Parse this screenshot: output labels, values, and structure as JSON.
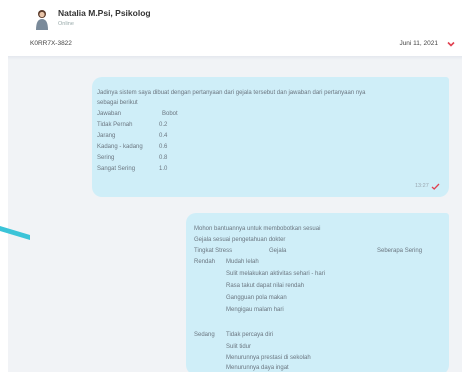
{
  "header": {
    "contact_name": "Natalia M.Psi, Psikolog",
    "contact_status": "Online",
    "ticket_id": "K0RR7X-3822",
    "date": "Juni 11, 2021"
  },
  "colors": {
    "bubble": "#cfeef8",
    "chat_background": "#f1f3f6",
    "accent": "#e04050"
  },
  "message_1": {
    "intro_line_1": "Jadinya sistem saya dibuat dengan pertanyaan dari gejala tersebut dan jawaban dari pertanyaan nya",
    "intro_line_2": "sebagai berikut",
    "table_headers": [
      "Jawaban",
      "Bobot"
    ],
    "rows": [
      {
        "answer": "Tidak Pernah",
        "weight": "0.2"
      },
      {
        "answer": "Jarang",
        "weight": "0.4"
      },
      {
        "answer": "Kadang - kadang",
        "weight": "0.6"
      },
      {
        "answer": "Sering",
        "weight": "0.8"
      },
      {
        "answer": "Sangat Sering",
        "weight": "1.0"
      }
    ],
    "time": "13:27"
  },
  "message_2": {
    "line_1": "Mohon bantuannya untuk membobotkan sesuai",
    "line_2": "Gejala sesuai pengetahuan dokter",
    "headers": [
      "Tingkat Stress",
      "Gejala",
      "Seberapa Sering"
    ],
    "level_1": "Rendah",
    "level_1_symptoms": [
      "Mudah lelah",
      "Sulit melakukan aktivitas sehari - hari",
      "Rasa takut dapat nilai rendah",
      "Gangguan pola makan",
      "Mengigau malam hari"
    ],
    "level_2": "Sedang",
    "level_2_symptoms": [
      "Tidak percaya diri",
      "Sulit tidur",
      "Menurunnya prestasi di sekolah",
      "Menurunnya daya ingat"
    ]
  }
}
